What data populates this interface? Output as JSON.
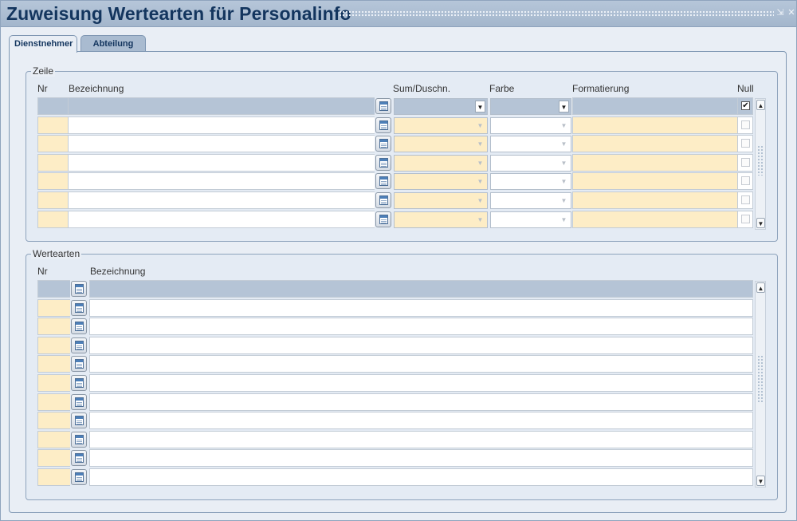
{
  "window": {
    "title": "Zuweisung Wertearten für Personalinfo",
    "minimize_glyph": "⇲",
    "close_glyph": "✕"
  },
  "tabs": [
    {
      "label": "Dienstnehmer",
      "active": true
    },
    {
      "label": "Abteilung",
      "active": false
    }
  ],
  "zeile": {
    "label": "Zeile",
    "columns": {
      "nr": "Nr",
      "bezeichnung": "Bezeichnung",
      "sum": "Sum/Duschn.",
      "farbe": "Farbe",
      "formatierung": "Formatierung",
      "null": "Null"
    },
    "rows": [
      {
        "nr": "",
        "bezeichnung": "",
        "sum": "",
        "farbe": "",
        "formatierung": "",
        "null": true,
        "current": true
      },
      {
        "nr": "",
        "bezeichnung": "",
        "sum": "",
        "farbe": "",
        "formatierung": "",
        "null": false
      },
      {
        "nr": "",
        "bezeichnung": "",
        "sum": "",
        "farbe": "",
        "formatierung": "",
        "null": false
      },
      {
        "nr": "",
        "bezeichnung": "",
        "sum": "",
        "farbe": "",
        "formatierung": "",
        "null": false
      },
      {
        "nr": "",
        "bezeichnung": "",
        "sum": "",
        "farbe": "",
        "formatierung": "",
        "null": false
      },
      {
        "nr": "",
        "bezeichnung": "",
        "sum": "",
        "farbe": "",
        "formatierung": "",
        "null": false
      },
      {
        "nr": "",
        "bezeichnung": "",
        "sum": "",
        "farbe": "",
        "formatierung": "",
        "null": false
      }
    ]
  },
  "wertearten": {
    "label": "Wertearten",
    "columns": {
      "nr": "Nr",
      "bezeichnung": "Bezeichnung"
    },
    "rows": [
      {
        "nr": "",
        "bezeichnung": "",
        "current": true
      },
      {
        "nr": "",
        "bezeichnung": ""
      },
      {
        "nr": "",
        "bezeichnung": ""
      },
      {
        "nr": "",
        "bezeichnung": ""
      },
      {
        "nr": "",
        "bezeichnung": ""
      },
      {
        "nr": "",
        "bezeichnung": ""
      },
      {
        "nr": "",
        "bezeichnung": ""
      },
      {
        "nr": "",
        "bezeichnung": ""
      },
      {
        "nr": "",
        "bezeichnung": ""
      },
      {
        "nr": "",
        "bezeichnung": ""
      },
      {
        "nr": "",
        "bezeichnung": ""
      }
    ]
  },
  "glyphs": {
    "dropdown": "▼",
    "scroll_up": "▲",
    "scroll_down": "▼",
    "checkmark": "✔"
  },
  "colors": {
    "title_text": "#13355e",
    "titlebar": "#a3b6cc",
    "required_field": "#fdedc6",
    "current_row": "#b5c4d6"
  }
}
